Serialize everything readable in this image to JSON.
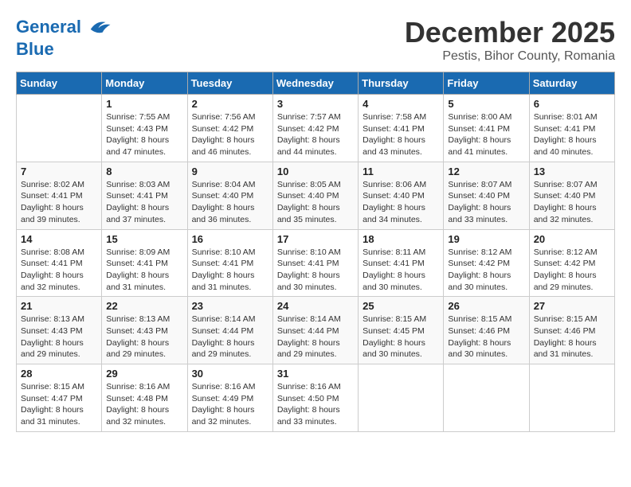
{
  "header": {
    "logo_line1": "General",
    "logo_line2": "Blue",
    "month": "December 2025",
    "location": "Pestis, Bihor County, Romania"
  },
  "weekdays": [
    "Sunday",
    "Monday",
    "Tuesday",
    "Wednesday",
    "Thursday",
    "Friday",
    "Saturday"
  ],
  "weeks": [
    [
      {
        "day": "",
        "sunrise": "",
        "sunset": "",
        "daylight": ""
      },
      {
        "day": "1",
        "sunrise": "Sunrise: 7:55 AM",
        "sunset": "Sunset: 4:43 PM",
        "daylight": "Daylight: 8 hours and 47 minutes."
      },
      {
        "day": "2",
        "sunrise": "Sunrise: 7:56 AM",
        "sunset": "Sunset: 4:42 PM",
        "daylight": "Daylight: 8 hours and 46 minutes."
      },
      {
        "day": "3",
        "sunrise": "Sunrise: 7:57 AM",
        "sunset": "Sunset: 4:42 PM",
        "daylight": "Daylight: 8 hours and 44 minutes."
      },
      {
        "day": "4",
        "sunrise": "Sunrise: 7:58 AM",
        "sunset": "Sunset: 4:41 PM",
        "daylight": "Daylight: 8 hours and 43 minutes."
      },
      {
        "day": "5",
        "sunrise": "Sunrise: 8:00 AM",
        "sunset": "Sunset: 4:41 PM",
        "daylight": "Daylight: 8 hours and 41 minutes."
      },
      {
        "day": "6",
        "sunrise": "Sunrise: 8:01 AM",
        "sunset": "Sunset: 4:41 PM",
        "daylight": "Daylight: 8 hours and 40 minutes."
      }
    ],
    [
      {
        "day": "7",
        "sunrise": "Sunrise: 8:02 AM",
        "sunset": "Sunset: 4:41 PM",
        "daylight": "Daylight: 8 hours and 39 minutes."
      },
      {
        "day": "8",
        "sunrise": "Sunrise: 8:03 AM",
        "sunset": "Sunset: 4:41 PM",
        "daylight": "Daylight: 8 hours and 37 minutes."
      },
      {
        "day": "9",
        "sunrise": "Sunrise: 8:04 AM",
        "sunset": "Sunset: 4:40 PM",
        "daylight": "Daylight: 8 hours and 36 minutes."
      },
      {
        "day": "10",
        "sunrise": "Sunrise: 8:05 AM",
        "sunset": "Sunset: 4:40 PM",
        "daylight": "Daylight: 8 hours and 35 minutes."
      },
      {
        "day": "11",
        "sunrise": "Sunrise: 8:06 AM",
        "sunset": "Sunset: 4:40 PM",
        "daylight": "Daylight: 8 hours and 34 minutes."
      },
      {
        "day": "12",
        "sunrise": "Sunrise: 8:07 AM",
        "sunset": "Sunset: 4:40 PM",
        "daylight": "Daylight: 8 hours and 33 minutes."
      },
      {
        "day": "13",
        "sunrise": "Sunrise: 8:07 AM",
        "sunset": "Sunset: 4:40 PM",
        "daylight": "Daylight: 8 hours and 32 minutes."
      }
    ],
    [
      {
        "day": "14",
        "sunrise": "Sunrise: 8:08 AM",
        "sunset": "Sunset: 4:41 PM",
        "daylight": "Daylight: 8 hours and 32 minutes."
      },
      {
        "day": "15",
        "sunrise": "Sunrise: 8:09 AM",
        "sunset": "Sunset: 4:41 PM",
        "daylight": "Daylight: 8 hours and 31 minutes."
      },
      {
        "day": "16",
        "sunrise": "Sunrise: 8:10 AM",
        "sunset": "Sunset: 4:41 PM",
        "daylight": "Daylight: 8 hours and 31 minutes."
      },
      {
        "day": "17",
        "sunrise": "Sunrise: 8:10 AM",
        "sunset": "Sunset: 4:41 PM",
        "daylight": "Daylight: 8 hours and 30 minutes."
      },
      {
        "day": "18",
        "sunrise": "Sunrise: 8:11 AM",
        "sunset": "Sunset: 4:41 PM",
        "daylight": "Daylight: 8 hours and 30 minutes."
      },
      {
        "day": "19",
        "sunrise": "Sunrise: 8:12 AM",
        "sunset": "Sunset: 4:42 PM",
        "daylight": "Daylight: 8 hours and 30 minutes."
      },
      {
        "day": "20",
        "sunrise": "Sunrise: 8:12 AM",
        "sunset": "Sunset: 4:42 PM",
        "daylight": "Daylight: 8 hours and 29 minutes."
      }
    ],
    [
      {
        "day": "21",
        "sunrise": "Sunrise: 8:13 AM",
        "sunset": "Sunset: 4:43 PM",
        "daylight": "Daylight: 8 hours and 29 minutes."
      },
      {
        "day": "22",
        "sunrise": "Sunrise: 8:13 AM",
        "sunset": "Sunset: 4:43 PM",
        "daylight": "Daylight: 8 hours and 29 minutes."
      },
      {
        "day": "23",
        "sunrise": "Sunrise: 8:14 AM",
        "sunset": "Sunset: 4:44 PM",
        "daylight": "Daylight: 8 hours and 29 minutes."
      },
      {
        "day": "24",
        "sunrise": "Sunrise: 8:14 AM",
        "sunset": "Sunset: 4:44 PM",
        "daylight": "Daylight: 8 hours and 29 minutes."
      },
      {
        "day": "25",
        "sunrise": "Sunrise: 8:15 AM",
        "sunset": "Sunset: 4:45 PM",
        "daylight": "Daylight: 8 hours and 30 minutes."
      },
      {
        "day": "26",
        "sunrise": "Sunrise: 8:15 AM",
        "sunset": "Sunset: 4:46 PM",
        "daylight": "Daylight: 8 hours and 30 minutes."
      },
      {
        "day": "27",
        "sunrise": "Sunrise: 8:15 AM",
        "sunset": "Sunset: 4:46 PM",
        "daylight": "Daylight: 8 hours and 31 minutes."
      }
    ],
    [
      {
        "day": "28",
        "sunrise": "Sunrise: 8:15 AM",
        "sunset": "Sunset: 4:47 PM",
        "daylight": "Daylight: 8 hours and 31 minutes."
      },
      {
        "day": "29",
        "sunrise": "Sunrise: 8:16 AM",
        "sunset": "Sunset: 4:48 PM",
        "daylight": "Daylight: 8 hours and 32 minutes."
      },
      {
        "day": "30",
        "sunrise": "Sunrise: 8:16 AM",
        "sunset": "Sunset: 4:49 PM",
        "daylight": "Daylight: 8 hours and 32 minutes."
      },
      {
        "day": "31",
        "sunrise": "Sunrise: 8:16 AM",
        "sunset": "Sunset: 4:50 PM",
        "daylight": "Daylight: 8 hours and 33 minutes."
      },
      {
        "day": "",
        "sunrise": "",
        "sunset": "",
        "daylight": ""
      },
      {
        "day": "",
        "sunrise": "",
        "sunset": "",
        "daylight": ""
      },
      {
        "day": "",
        "sunrise": "",
        "sunset": "",
        "daylight": ""
      }
    ]
  ]
}
